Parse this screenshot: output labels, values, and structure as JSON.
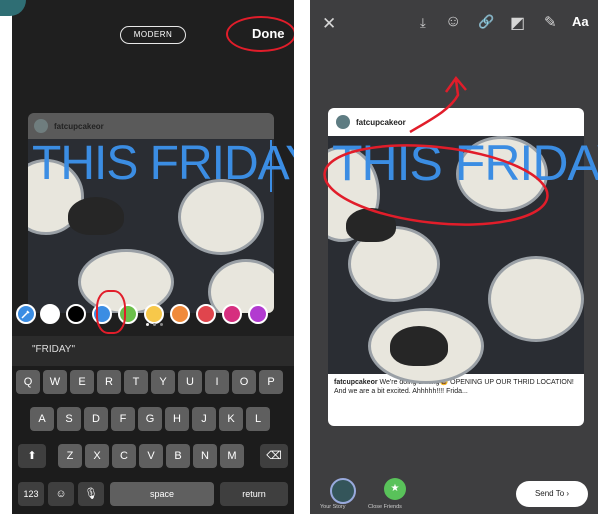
{
  "editor": {
    "mode_label": "MODERN",
    "done_label": "Done",
    "username": "fatcupcakeor",
    "story_text": "THIS FRIDAY",
    "suggestion": "\"FRIDAY\"",
    "colors": [
      "#ffffff",
      "#000000",
      "#3b8de3",
      "#6bbf4a",
      "#f7c84a",
      "#f08a3b",
      "#e0454d",
      "#d62f7f",
      "#b23ad0"
    ],
    "keyboard": {
      "row1": [
        "Q",
        "W",
        "E",
        "R",
        "T",
        "Y",
        "U",
        "I",
        "O",
        "P"
      ],
      "row2": [
        "A",
        "S",
        "D",
        "F",
        "G",
        "H",
        "J",
        "K",
        "L"
      ],
      "row3": [
        "Z",
        "X",
        "C",
        "V",
        "B",
        "N",
        "M"
      ],
      "num_label": "123",
      "space_label": "space",
      "return_label": "return"
    }
  },
  "preview": {
    "aa_label": "Aa",
    "username": "fatcupcakeor",
    "story_text": "THIS FRIDAY",
    "caption_user": "fatcupcakeor",
    "caption_text": " We're doing a thing😀 OPENING UP OUR THRID LOCATION! And we are a bit excited. Ahhhhh!!!! Frida...",
    "your_story_label": "Your Story",
    "close_friends_label": "Close Friends",
    "send_label": "Send To"
  }
}
